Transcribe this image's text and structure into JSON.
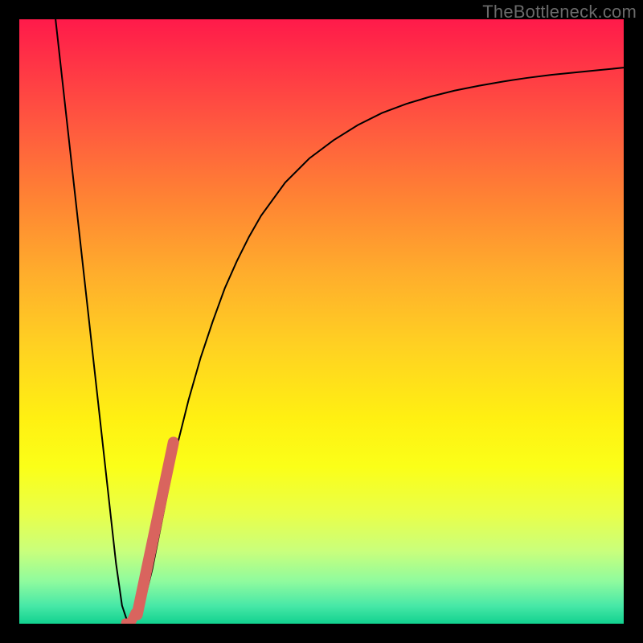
{
  "watermark": "TheBottleneck.com",
  "chart_data": {
    "type": "line",
    "title": "",
    "xlabel": "",
    "ylabel": "",
    "xlim": [
      0,
      100
    ],
    "ylim": [
      0,
      100
    ],
    "grid": false,
    "series": [
      {
        "name": "bottleneck-curve",
        "stroke": "#000000",
        "stroke_width": 2,
        "x": [
          6,
          7,
          8,
          9,
          10,
          11,
          12,
          13,
          14,
          15,
          16,
          17,
          18,
          19,
          20,
          21,
          22,
          23,
          24,
          25,
          26,
          28,
          30,
          32,
          34,
          36,
          38,
          40,
          44,
          48,
          52,
          56,
          60,
          64,
          68,
          72,
          76,
          80,
          84,
          88,
          92,
          96,
          100
        ],
        "y": [
          100,
          91,
          82,
          73,
          64,
          55,
          46,
          37,
          28,
          19,
          10,
          3,
          0,
          0.3,
          2,
          5,
          9,
          14,
          19,
          24,
          29,
          37,
          44,
          50,
          55.5,
          60,
          64,
          67.5,
          73,
          77,
          80,
          82.5,
          84.5,
          86,
          87.2,
          88.2,
          89,
          89.7,
          90.3,
          90.8,
          91.2,
          91.6,
          92
        ]
      },
      {
        "name": "highlight-segment",
        "stroke": "#d9645e",
        "stroke_width": 14,
        "linecap": "round",
        "x": [
          19.5,
          25.5
        ],
        "y": [
          1.5,
          30
        ]
      },
      {
        "name": "highlight-dot-lower",
        "stroke": "#d9645e",
        "stroke_width": 12,
        "linecap": "round",
        "x": [
          18.6,
          19.2
        ],
        "y": [
          0.5,
          1.8
        ]
      },
      {
        "name": "highlight-dot-bottom",
        "stroke": "#d9645e",
        "stroke_width": 10,
        "linecap": "round",
        "x": [
          17.5,
          17.9
        ],
        "y": [
          0.2,
          0.2
        ]
      }
    ]
  }
}
